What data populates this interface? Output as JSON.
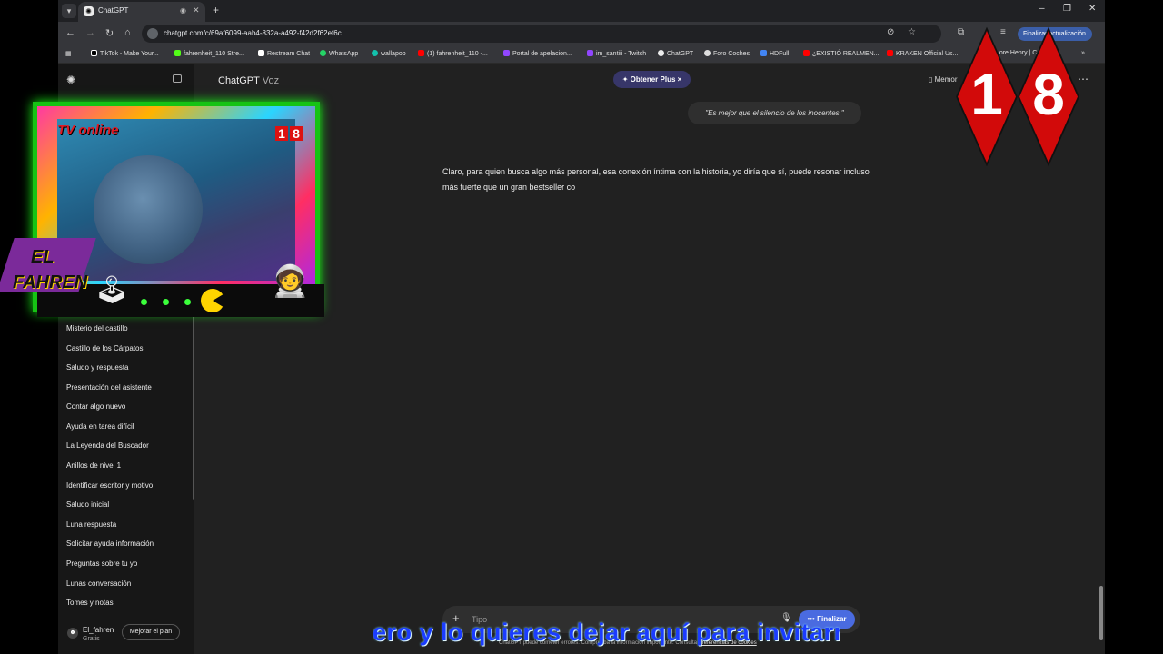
{
  "browser": {
    "tab_title": "ChatGPT",
    "url": "chatgpt.com/c/69af6099-aab4-832a-a492-f42d2f62ef6c",
    "update_button": "Finalizar actualización",
    "bookmarks": [
      "TikTok - Make Your...",
      "fahrenheit_110 Stre...",
      "Restream Chat",
      "WhatsApp",
      "wallapop",
      "(1) fahrenheit_110 -...",
      "Portal de apelacion...",
      "im_santiii - Twitch",
      "ChatGPT",
      "Foro Coches",
      "HDFull",
      "¿EXISTIÓ REALMEN...",
      "KRAKEN Official Us...",
      "...ore Henry | C..."
    ]
  },
  "app": {
    "title": "ChatGPT",
    "title_sub": "Voz",
    "plus_pill": "✦ Obtener Plus  ×",
    "memory_label": "Memor"
  },
  "sidebar": {
    "items": [
      "Misterio del castillo",
      "Castillo de los Cárpatos",
      "Saludo y respuesta",
      "Presentación del asistente",
      "Contar algo nuevo",
      "Ayuda en tarea difícil",
      "La Leyenda del Buscador",
      "Anillos de nivel 1",
      "Identificar escritor y motivo",
      "Saludo inicial",
      "Luna respuesta",
      "Solicitar ayuda información",
      "Preguntas sobre tu yo",
      "Lunas conversación",
      "Tomes y notas"
    ],
    "user_name": "El_fahren",
    "user_plan": "Gratis",
    "upgrade_label": "Mejorar el plan"
  },
  "chat": {
    "user_message": "\"Es mejor que el silencio de los inocentes.\"",
    "assistant_message": "Claro, para quien busca algo más personal, esa conexión íntima con la historia, yo diría que sí, puede resonar incluso más fuerte que un gran bestseller co"
  },
  "composer": {
    "placeholder": "Tipo",
    "finish_label": "••• Finalizar",
    "disclaimer": "ChatGPT puede cometer errores. Comprueba la información importante. Consulta ",
    "disclaimer_link": "Preferencias de cookies"
  },
  "overlay": {
    "tv_label": "TV online",
    "cam_badge_1": "1",
    "cam_badge_8": "8",
    "fahren_1": "EL",
    "fahren_2": "FAHREN",
    "big_digit_1": "1",
    "big_digit_8": "8",
    "subtitle": "ero y lo quieres dejar aquí para invitarme"
  },
  "colors": {
    "background": "#212121",
    "sidebar": "#171717",
    "plus_pill": "#373669",
    "finish_button": "#4a6be0",
    "badge_red": "#d20a0a",
    "subtitle_blue": "#1b3cff"
  }
}
